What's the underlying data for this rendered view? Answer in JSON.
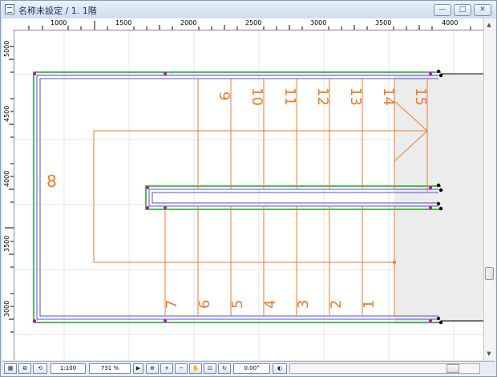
{
  "window": {
    "title": "名称未設定 / 1. 1階",
    "buttons": {
      "minimize": "—",
      "maximize": "□",
      "close": "✕"
    }
  },
  "rulers": {
    "top_labels": [
      "1000",
      "1500",
      "2000",
      "2500",
      "3000",
      "3500",
      "4000"
    ],
    "left_labels": [
      "5000",
      "4500",
      "4000",
      "3500",
      "3000"
    ]
  },
  "drawing": {
    "step_numbers_upper": [
      "9",
      "10",
      "11",
      "12",
      "13",
      "14",
      "15"
    ],
    "step_numbers_lower": [
      "7",
      "6",
      "5",
      "4",
      "3",
      "2",
      "1"
    ],
    "landing_number": "8",
    "colors": {
      "outline": "#1fa31f",
      "inner": "#5050d8",
      "steps": "#f07a28",
      "magenta": "#cc00cc",
      "shade": "#ececec"
    }
  },
  "statusbar": {
    "scale": "1:100",
    "zoom": "731 %",
    "angle": "0.00°"
  },
  "icons": [
    "drawing-file-icon",
    "zoom-in-icon",
    "zoom-out-icon",
    "pan-icon",
    "fit-icon",
    "rotate-icon"
  ]
}
